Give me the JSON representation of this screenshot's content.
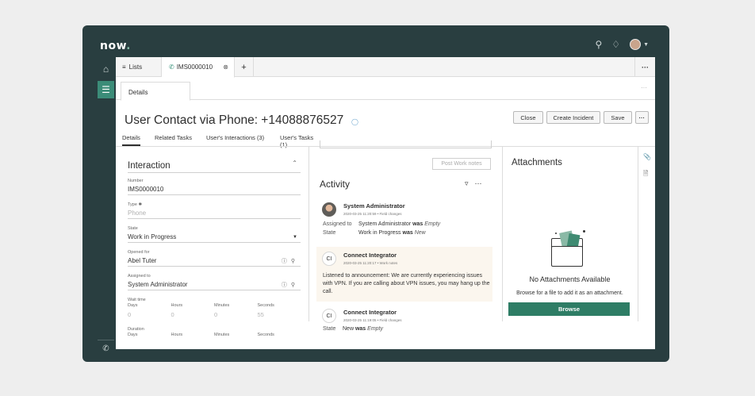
{
  "header": {
    "logo": "now",
    "logo_dot": ".",
    "icons": [
      "search-icon",
      "bell-icon",
      "avatar"
    ]
  },
  "tabs": {
    "lists": "Lists",
    "record": "IMS0000010",
    "add": "+",
    "more": "···"
  },
  "subtab": {
    "details": "Details",
    "more": "···"
  },
  "record": {
    "title": "User Contact via Phone: +14088876527",
    "buttons": {
      "close": "Close",
      "create_incident": "Create Incident",
      "save": "Save",
      "more": "···"
    }
  },
  "related_tabs": [
    "Details",
    "Related Tasks",
    "User's Interactions (3)",
    "User's Tasks (1)"
  ],
  "form": {
    "section_title": "Interaction",
    "number": {
      "label": "Number",
      "value": "IMS0000010"
    },
    "type": {
      "label": "Type ✱",
      "value": "Phone"
    },
    "state": {
      "label": "State",
      "value": "Work in Progress"
    },
    "opened_for": {
      "label": "Opened for",
      "value": "Abel Tuter"
    },
    "assigned_to": {
      "label": "Assigned to",
      "value": "System Administrator"
    },
    "wait_time": {
      "label": "Wait time",
      "units": [
        "Days",
        "Hours",
        "Minutes",
        "Seconds"
      ],
      "values": [
        "0",
        "0",
        "0",
        "55"
      ]
    },
    "duration": {
      "label": "Duration",
      "units": [
        "Days",
        "Hours",
        "Minutes",
        "Seconds"
      ]
    }
  },
  "activity": {
    "post_button": "Post Work notes",
    "title": "Activity",
    "entries": [
      {
        "name": "System Administrator",
        "meta": "2020-03-25 11:20:59 • Field changes",
        "changes": [
          {
            "field": "Assigned to",
            "value": "System Administrator",
            "was": "was",
            "old": "Empty"
          },
          {
            "field": "State",
            "value": "Work in Progress",
            "was": "was",
            "old": "New"
          }
        ]
      },
      {
        "initials": "CI",
        "name": "Connect Integrator",
        "meta": "2020-03-25 11:20:17 • Work notes",
        "text": "Listened to announcement: We are currently experiencing issues with VPN. If you are calling about VPN issues, you may hang up the call."
      },
      {
        "initials": "CI",
        "name": "Connect Integrator",
        "meta": "2020-03-25 11:19:05 • Field changes",
        "changes": [
          {
            "field": "State",
            "value": "New",
            "was": "was",
            "old": "Empty"
          }
        ]
      }
    ]
  },
  "attachments": {
    "title": "Attachments",
    "empty": "No Attachments Available",
    "hint": "Browse for a file to add it as an attachment.",
    "browse": "Browse"
  },
  "colors": {
    "frame": "#293e40",
    "accent": "#2e7d65",
    "nav_active": "#3b8c78"
  }
}
